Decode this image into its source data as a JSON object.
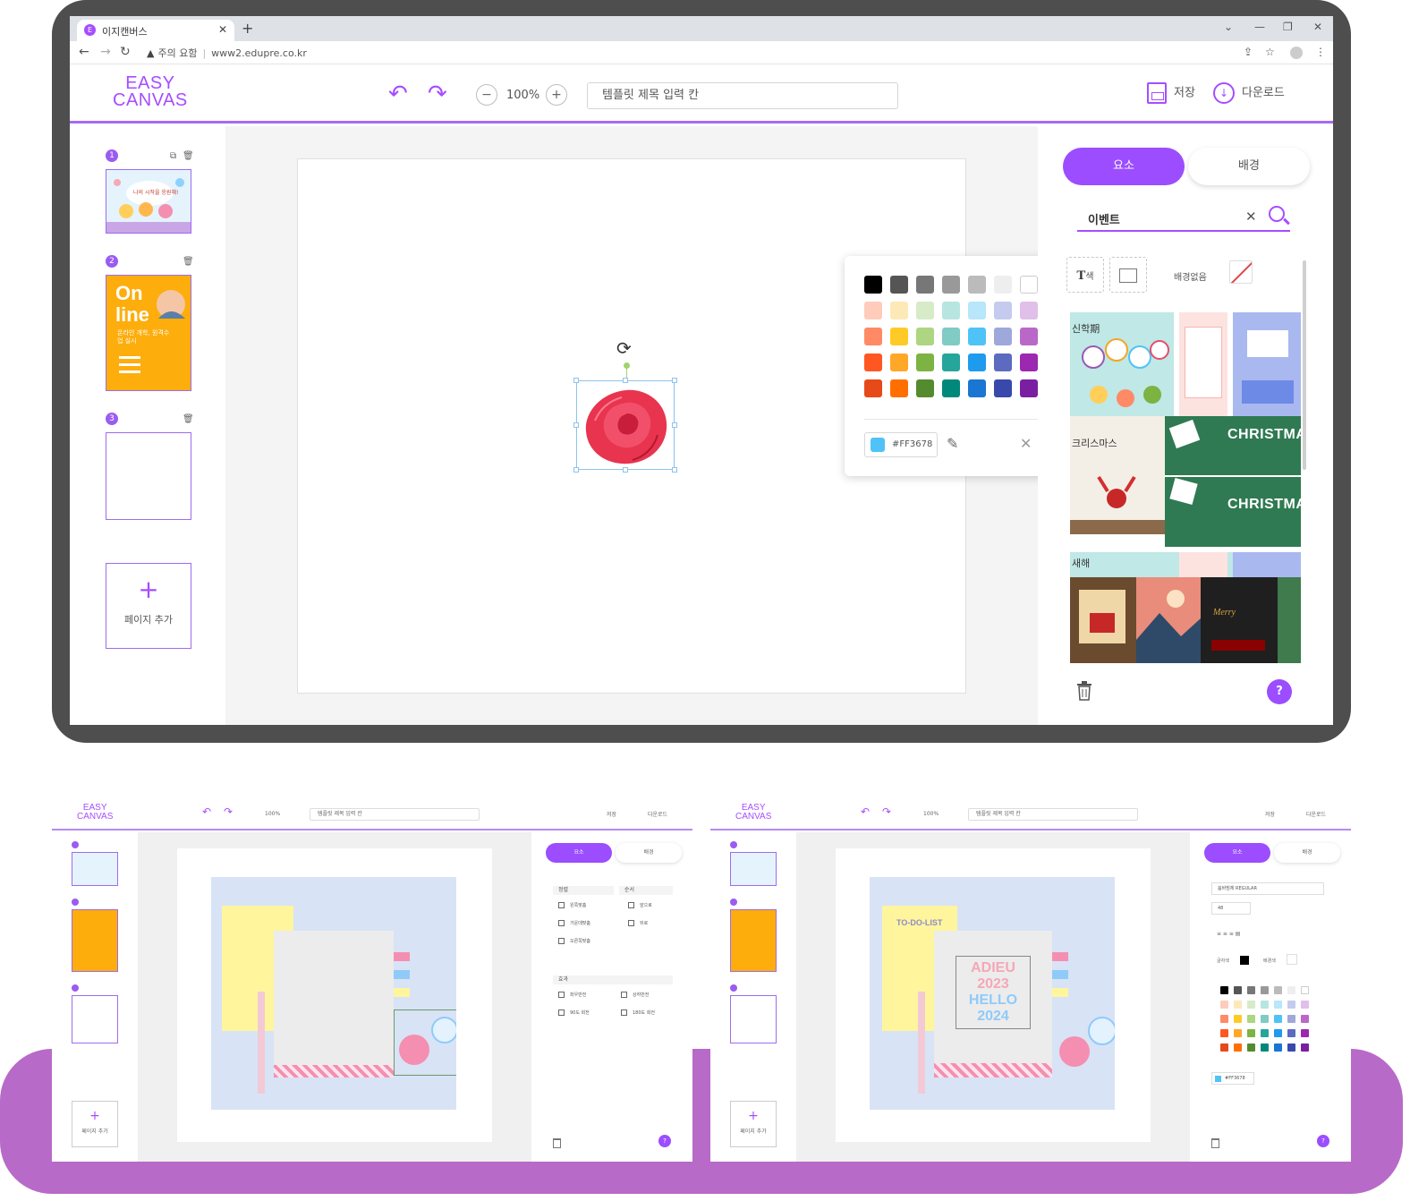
{
  "browser": {
    "tab_title": "이지캔버스",
    "tab_favicon": "E",
    "security_label": "주의 요함",
    "url": "www2.edupre.co.kr"
  },
  "app": {
    "logo_line1": "EASY",
    "logo_line2": "CANVAS",
    "zoom": "100%",
    "title_placeholder": "템플릿 제목 입력 칸",
    "save_label": "저장",
    "download_label": "다운로드",
    "accent_color": "#9b4dff"
  },
  "pages": {
    "items": [
      {
        "number": "1"
      },
      {
        "number": "2"
      },
      {
        "number": "3"
      }
    ],
    "add_label": "페이지 추가",
    "thumb1_text": "나의 시작을 응원해!",
    "thumb2_big": "On line",
    "thumb2_sub": "온라인 개학, 원격수업 실시"
  },
  "canvas": {
    "element": "rose-flower"
  },
  "color_picker": {
    "swatches": [
      [
        "#000000",
        "#555555",
        "#777777",
        "#999999",
        "#bbbbbb",
        "#eeeeee",
        "#ffffff"
      ],
      [
        "#ffcbbb",
        "#fde8b8",
        "#d7ebc9",
        "#b7e6e0",
        "#b8e6fb",
        "#c5cbee",
        "#e0bfe8"
      ],
      [
        "#ff8a65",
        "#ffca28",
        "#aed581",
        "#80cbc4",
        "#4fc3f7",
        "#9fa8da",
        "#ba68c8"
      ],
      [
        "#ff5722",
        "#ffa726",
        "#7cb342",
        "#26a69a",
        "#1e9bef",
        "#5c6bc0",
        "#9c27b0"
      ],
      [
        "#e64a19",
        "#ff6f00",
        "#558b2f",
        "#00897b",
        "#1976d2",
        "#3949ab",
        "#7b1fa2"
      ]
    ],
    "current_hex": "#FF3678",
    "current_color": "#4fc3f7"
  },
  "right_panel": {
    "tab_elements": "요소",
    "tab_background": "배경",
    "search_query": "이벤트",
    "font_color_label": "색",
    "no_background_label": "배경없음",
    "thumbnails": [
      {
        "caption": "신학期"
      },
      {
        "caption": "크리스마스"
      },
      {
        "caption": "CHRISTMAS"
      },
      {
        "caption": "CHRISTMAS"
      },
      {
        "caption": "새해"
      }
    ],
    "help_label": "?"
  },
  "mini_left": {
    "section_align": "정렬",
    "section_order": "순서",
    "section_effect": "효과",
    "align_items": [
      "왼쪽맞춤",
      "가운데맞춤",
      "오른쪽맞춤"
    ],
    "order_items": [
      "앞으로",
      "뒤로"
    ],
    "effect_items": [
      "좌우반전",
      "상하반전",
      "90도 회전",
      "180도 회전"
    ]
  },
  "mini_right": {
    "font_name": "붐바빔체 REGULAR",
    "font_size": "48",
    "text_lines": [
      "ADIEU",
      "2023",
      "HELLO",
      "2024"
    ],
    "todo_label": "TO-DO-LIST",
    "font_color_label": "글자색",
    "bg_color_label": "배경색",
    "hex": "#FF3678"
  }
}
